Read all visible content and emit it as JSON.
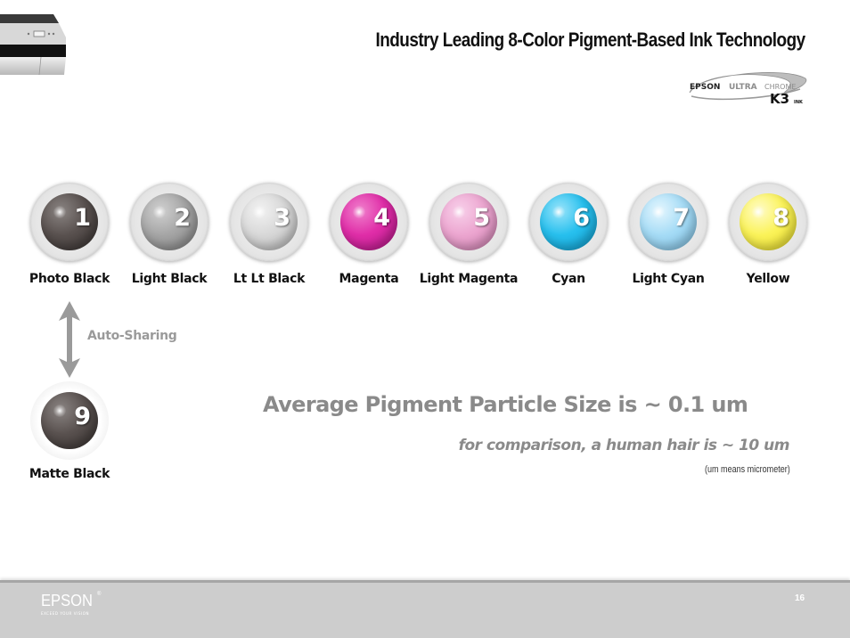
{
  "slide": {
    "title": "Industry Leading 8-Color Pigment-Based Ink Technology",
    "logo": {
      "brand": "EPSON",
      "product_bold": "ULTRA",
      "product_light": "CHROME",
      "series": "K3",
      "suffix": "INK"
    },
    "inks": [
      {
        "number": "1",
        "label": "Photo Black",
        "color": "#5a5250"
      },
      {
        "number": "2",
        "label": "Light Black",
        "color": "#a6a6a6"
      },
      {
        "number": "3",
        "label": "Lt Lt Black",
        "color": "#d8d8d8"
      },
      {
        "number": "4",
        "label": "Magenta",
        "color": "#e02ea8"
      },
      {
        "number": "5",
        "label": "Light Magenta",
        "color": "#eca6d0"
      },
      {
        "number": "6",
        "label": "Cyan",
        "color": "#28c0ee"
      },
      {
        "number": "7",
        "label": "Light Cyan",
        "color": "#a6dcf6"
      },
      {
        "number": "8",
        "label": "Yellow",
        "color": "#fbf35a"
      }
    ],
    "shared_ink": {
      "number": "9",
      "label": "Matte Black",
      "color": "#5a5250"
    },
    "sharing_label": "Auto-Sharing",
    "headline": "Average Pigment Particle Size is ~ 0.1 um",
    "comparison": "for comparison, a human hair is ~ 10 um",
    "footnote": "(um means micrometer)"
  },
  "footer": {
    "brand": "EPSON",
    "trademark": "®",
    "tagline": "EXCEED YOUR VISION",
    "page_number": "16"
  },
  "icons": {
    "printer": "printer-photo",
    "arrow": "double-arrow-vertical"
  }
}
